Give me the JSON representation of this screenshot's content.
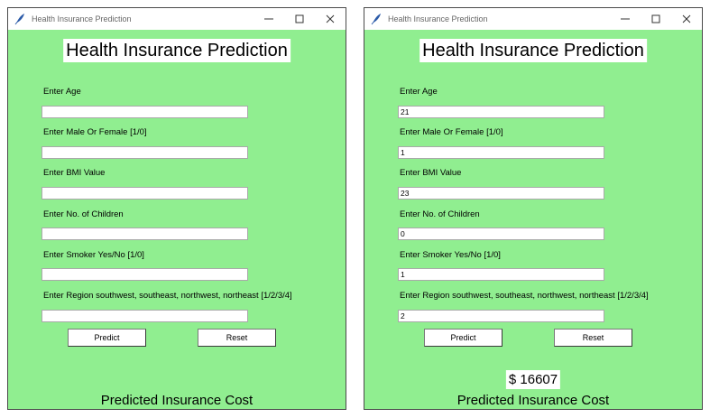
{
  "left_window": {
    "title": "Health Insurance Prediction",
    "heading": "Health Insurance Prediction",
    "fields": [
      {
        "label": "Enter Age",
        "value": ""
      },
      {
        "label": "Enter Male Or Female [1/0]",
        "value": ""
      },
      {
        "label": "Enter BMI Value",
        "value": ""
      },
      {
        "label": "Enter No. of Children",
        "value": ""
      },
      {
        "label": "Enter Smoker Yes/No [1/0]",
        "value": ""
      },
      {
        "label": "Enter Region southwest, southeast, northwest, northeast [1/2/3/4]",
        "value": ""
      }
    ],
    "predict_label": "Predict",
    "reset_label": "Reset",
    "footer": "Predicted Insurance Cost"
  },
  "right_window": {
    "title": "Health Insurance Prediction",
    "heading": "Health Insurance Prediction",
    "fields": [
      {
        "label": "Enter Age",
        "value": "21"
      },
      {
        "label": "Enter Male Or Female [1/0]",
        "value": "1"
      },
      {
        "label": "Enter BMI Value",
        "value": "23"
      },
      {
        "label": "Enter No. of Children",
        "value": "0"
      },
      {
        "label": "Enter Smoker Yes/No [1/0]",
        "value": "1"
      },
      {
        "label": "Enter Region southwest, southeast, northwest, northeast [1/2/3/4]",
        "value": "2"
      }
    ],
    "predict_label": "Predict",
    "reset_label": "Reset",
    "result": "$ 16607",
    "footer": "Predicted Insurance Cost"
  },
  "icons": {
    "app": "feather-icon",
    "minimize": "minimize-icon",
    "maximize": "maximize-icon",
    "close": "close-icon"
  },
  "colors": {
    "window_background": "#90ee90",
    "titlebar": "#ffffff"
  }
}
